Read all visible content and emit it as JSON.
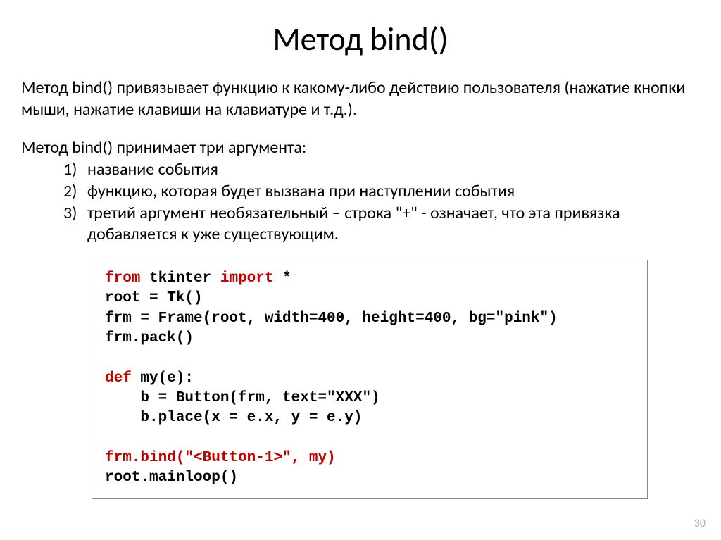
{
  "title": "Метод bind()",
  "paragraph1": "Метод bind() привязывает функцию к какому-либо действию пользователя (нажатие кнопки мыши, нажатие клавиши на клавиатуре и т.д.).",
  "arguments_intro": "Метод bind() принимает три аргумента:",
  "arguments": [
    "название события",
    "функцию, которая будет вызвана при наступлении события",
    "третий аргумент необязательный – строка \"+\" - означает, что эта привязка добавляется к уже существующим."
  ],
  "code": {
    "l1a": "from",
    "l1b": " tkinter ",
    "l1c": "import",
    "l1d": " *",
    "l2": "root = Tk()",
    "l3": "frm = Frame(root, width=400, height=400, bg=\"pink\")",
    "l4": "frm.pack()",
    "l5": "",
    "l6a": "def",
    "l6b": " my(e):",
    "l7": "    b = Button(frm, text=\"XXX\")",
    "l8": "    b.place(x = e.x, y = e.y)",
    "l9": "",
    "l10": "frm.bind(\"<Button-1>\", my)",
    "l11": "root.mainloop()"
  },
  "page_number": "30"
}
